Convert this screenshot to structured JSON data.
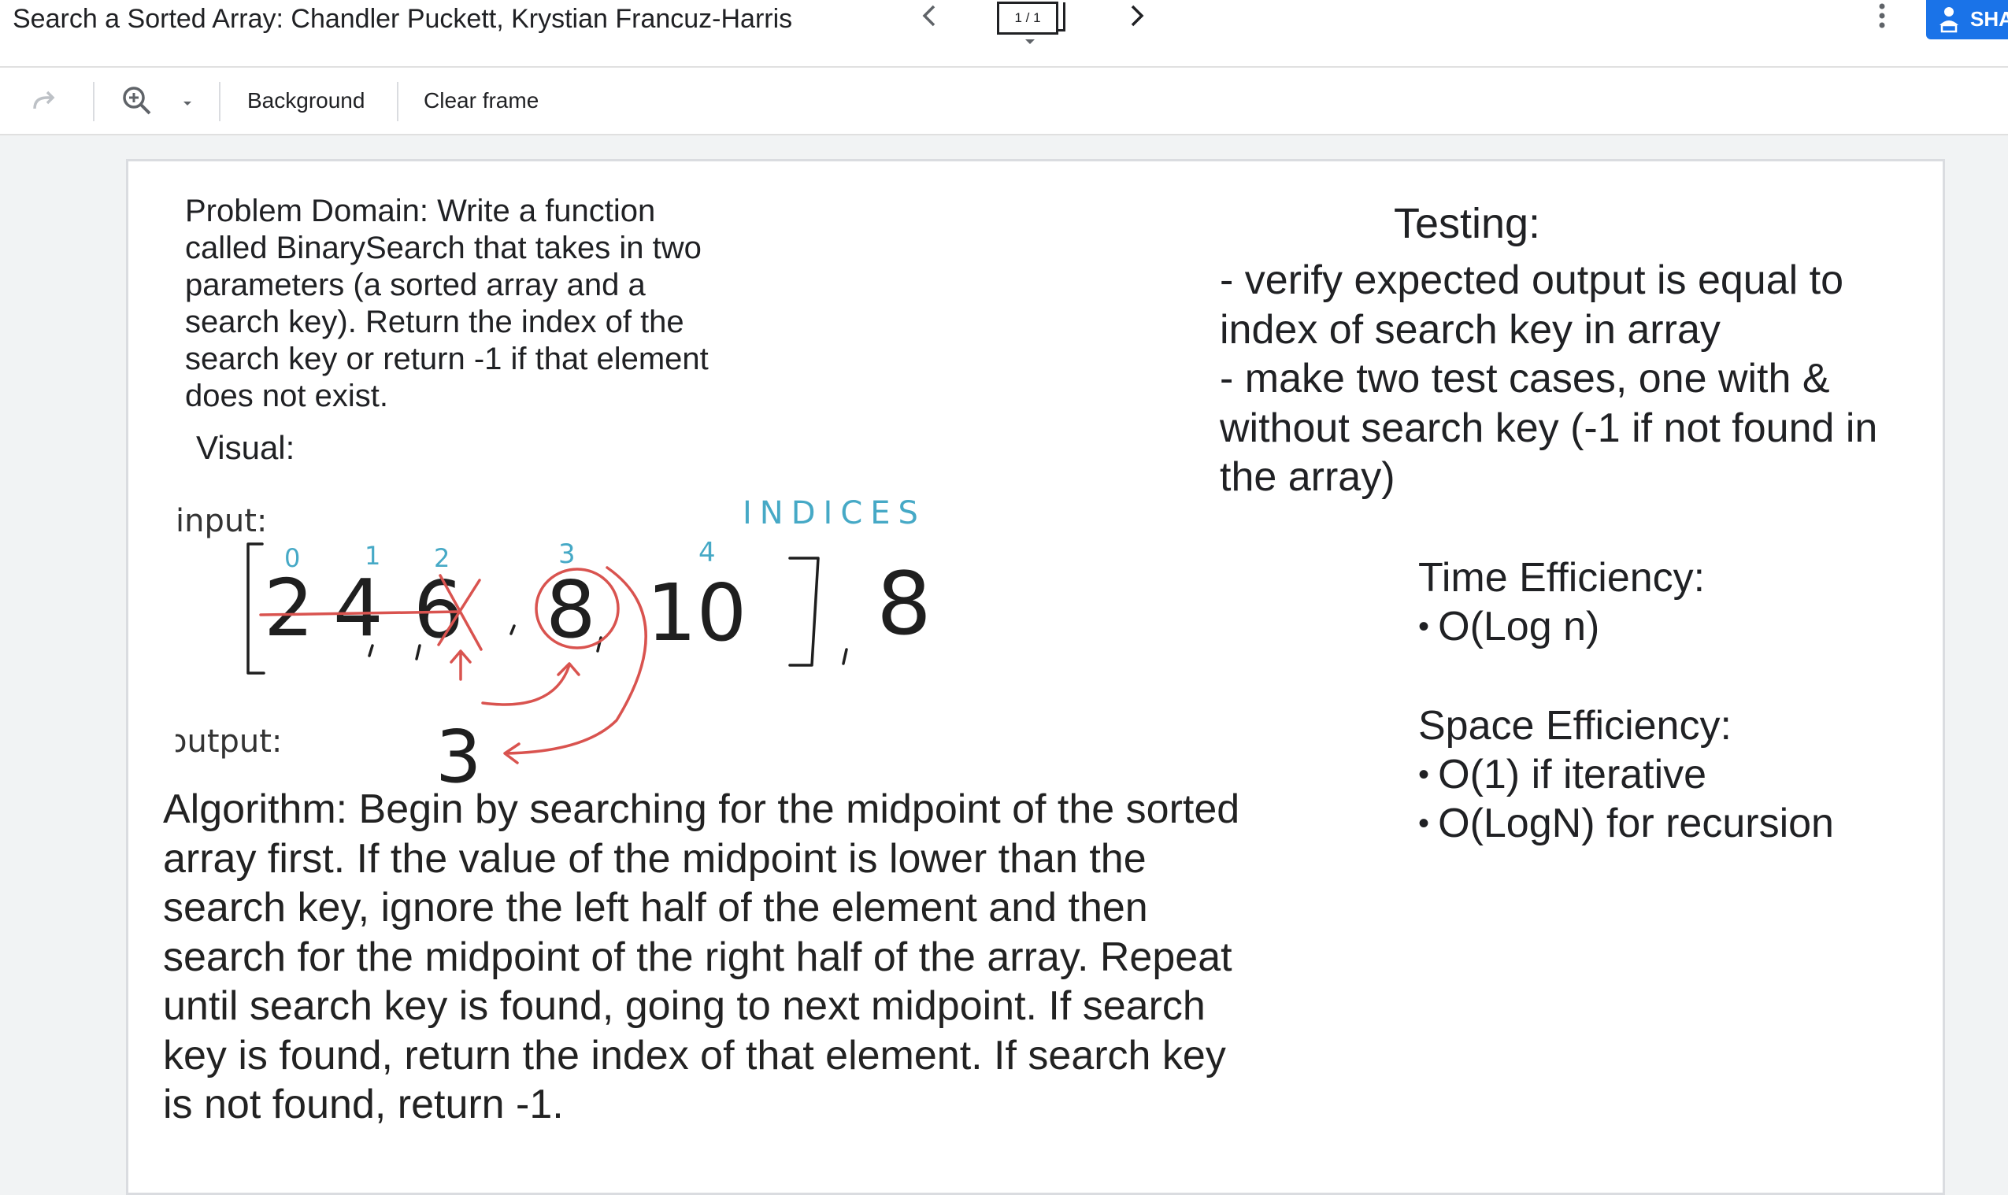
{
  "header": {
    "title": "Search a Sorted Array: Chandler Puckett, Krystian Francuz-Harris",
    "frame_indicator": "1 / 1",
    "share_label": "SHA"
  },
  "toolbar": {
    "background_label": "Background",
    "clear_frame_label": "Clear frame"
  },
  "canvas": {
    "problem_domain": "Problem Domain: Write a function called BinarySearch that takes in two parameters (a sorted array and a search key). Return the index of the search key or return -1 if that element does not exist.",
    "visual_label": "Visual:",
    "algorithm": "Algorithm: Begin by searching for the midpoint of the sorted array first. If the value of the midpoint is lower than the search key, ignore the left half of the element and then search for the midpoint of the right half of the array. Repeat until search key is found, going to next midpoint. If search key is found, return the index of that element. If search key is not found, return -1.",
    "testing": {
      "heading": "Testing:",
      "items": [
        "- verify expected output is equal to index of search key in array",
        "- make two test cases, one with & without search key (-1 if not found in the array)"
      ]
    },
    "time_efficiency": {
      "heading": "Time Efficiency:",
      "items": [
        "O(Log n)"
      ]
    },
    "space_efficiency": {
      "heading": "Space Efficiency:",
      "items": [
        "O(1) if iterative",
        "O(LogN) for recursion"
      ]
    },
    "sketch": {
      "input_label": "input:",
      "output_label": "output:",
      "indices_label": "INDICES",
      "array_values": [
        "2",
        "4",
        "6",
        "8",
        "10"
      ],
      "index_values": [
        "0",
        "1",
        "2",
        "3",
        "4"
      ],
      "search_key": "8",
      "output_value": "3"
    }
  },
  "colors": {
    "share_blue": "#1a73e8",
    "ink_black": "#1f1f1f",
    "ink_red": "#d9534f",
    "ink_teal": "#46a9c6"
  }
}
